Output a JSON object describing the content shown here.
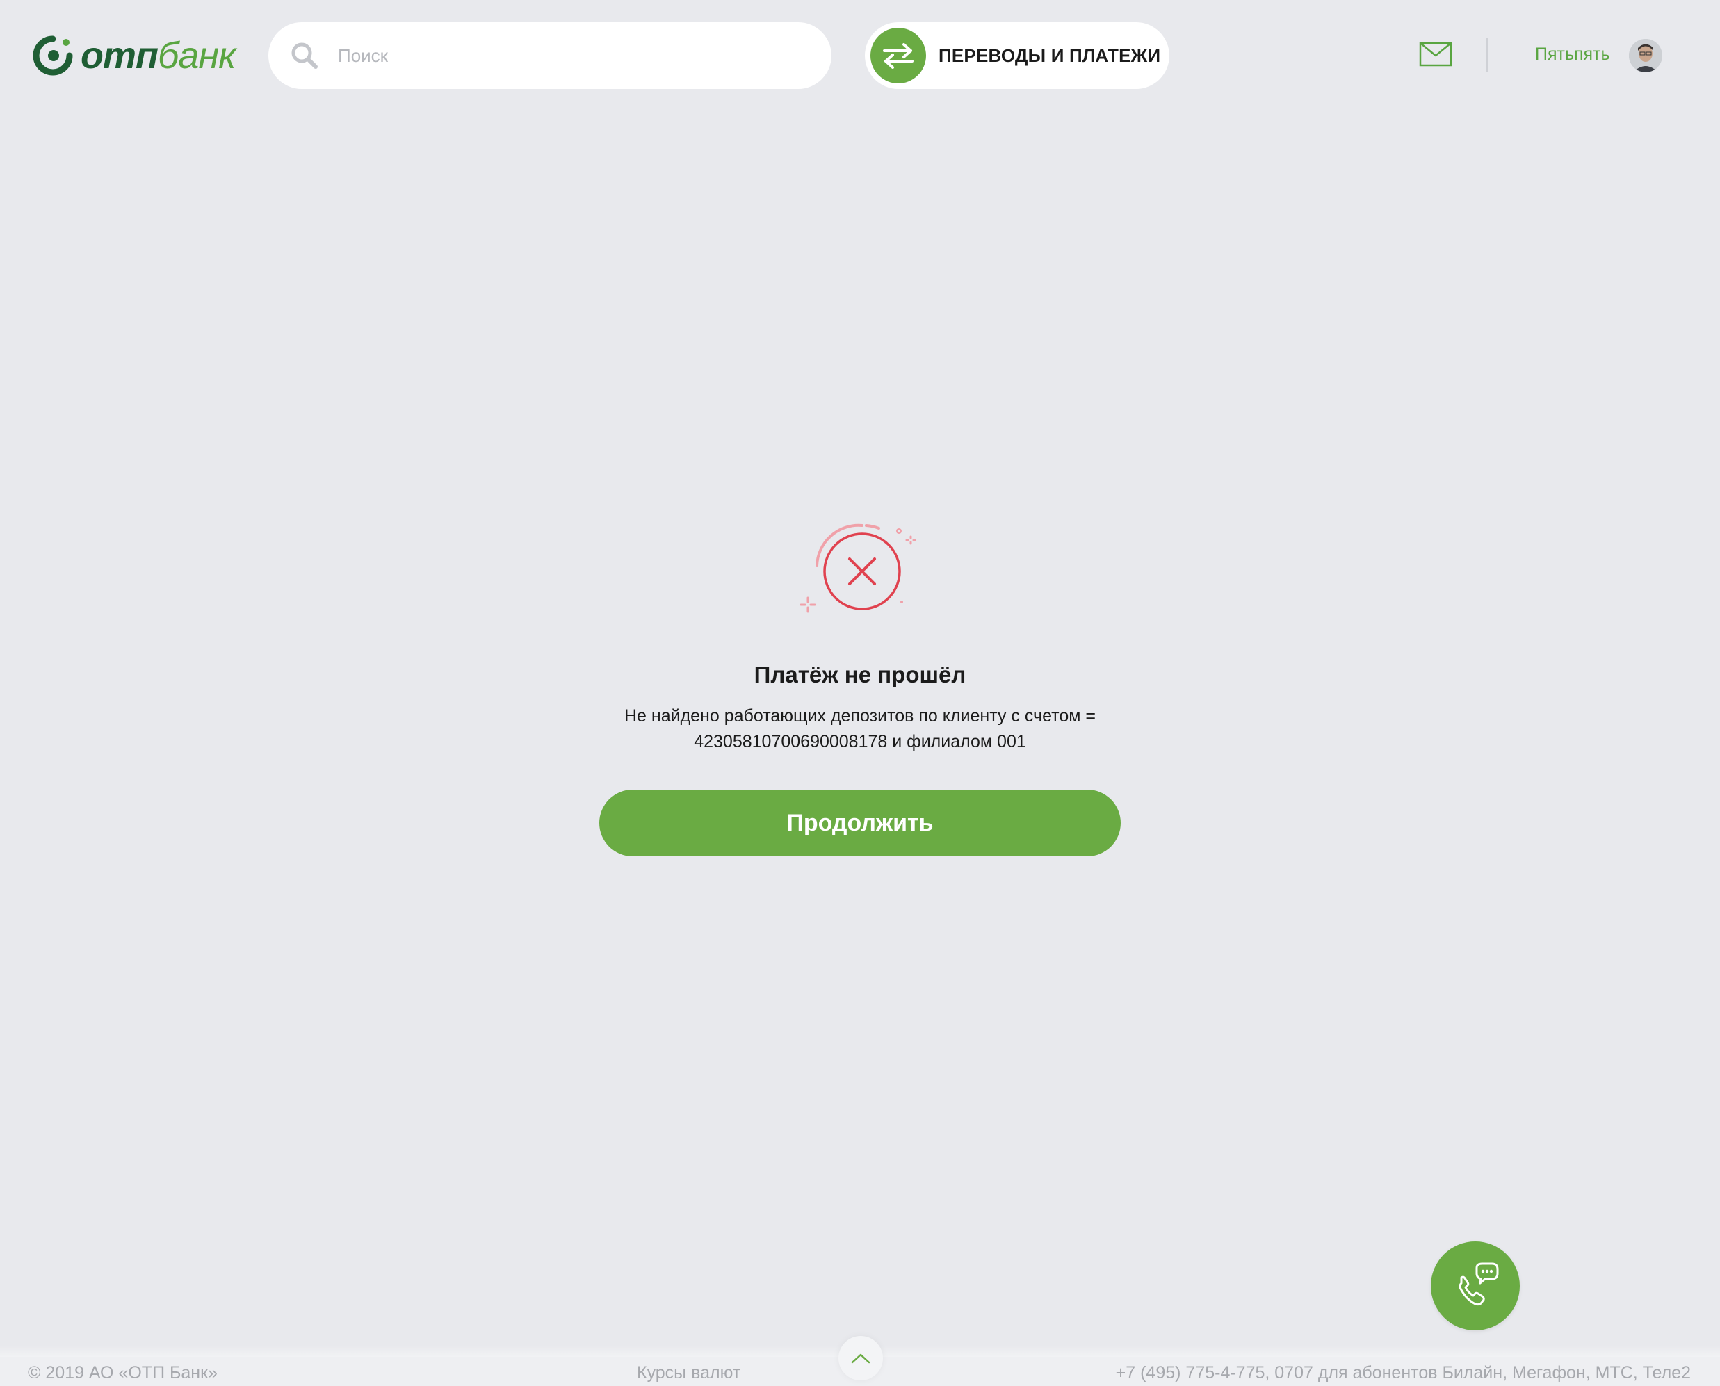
{
  "header": {
    "logo": {
      "otp": "отп",
      "bank": "банк"
    },
    "search": {
      "placeholder": "Поиск"
    },
    "transfers_label": "ПЕРЕВОДЫ И ПЛАТЕЖИ",
    "user_name": "Пятьпять"
  },
  "main": {
    "error_title": "Платёж не прошёл",
    "error_line1": "Не найдено работающих депозитов по клиенту с счетом =",
    "error_line2": "42305810700690008178 и филиалом 001",
    "continue_label": "Продолжить"
  },
  "footer": {
    "copyright": "© 2019 АО «ОТП Банк»",
    "rates": "Курсы валют",
    "phones": "+7 (495) 775-4-775,  0707 для абонентов Билайн, Мегафон, МТС, Теле2"
  },
  "icons": {
    "search": "search-icon",
    "transfers": "arrows-exchange-icon",
    "mail": "envelope-icon",
    "error": "error-x-icon",
    "call": "phone-chat-icon",
    "scroll_top": "chevron-up-icon"
  },
  "colors": {
    "brand_green": "#6aab43",
    "dark_green": "#1f5e34",
    "error_red": "#e0424f",
    "background": "#e8e9ed"
  }
}
